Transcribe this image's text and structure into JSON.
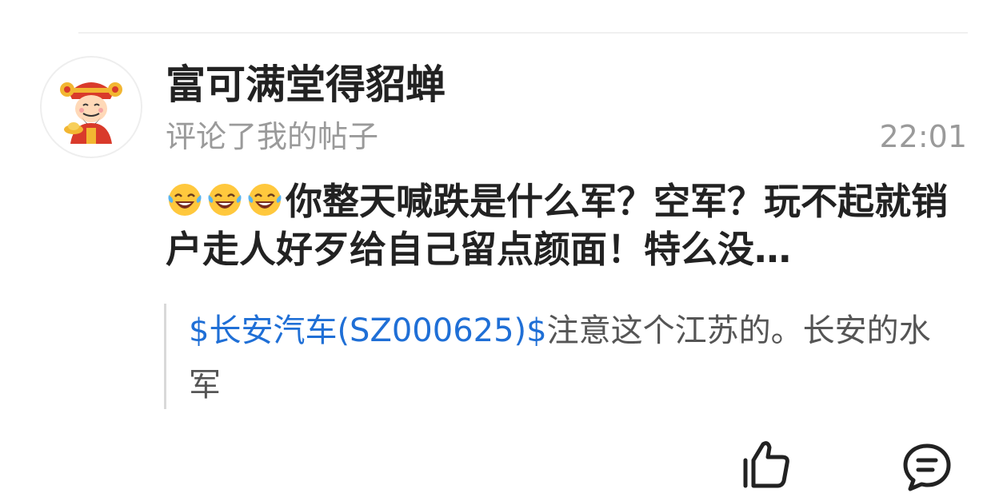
{
  "post": {
    "username": "富可满堂得貂蝉",
    "action": "评论了我的帖子",
    "time": "22:01",
    "emojis": [
      "laughing-crying-emoji",
      "laughing-crying-emoji",
      "laughing-crying-emoji"
    ],
    "comment_text": "你整天喊跌是什么军？空军？玩不起就销户走人好歹给自己留点颜面！特么没…",
    "quote": {
      "stock_link": "$长安汽车(SZ000625)$",
      "text": "注意这个江苏的。长安的水军"
    }
  },
  "actions": {
    "like_icon": "thumbs-up-icon",
    "comment_icon": "comment-bubble-icon"
  },
  "colors": {
    "link": "#1f6fd6",
    "secondary_text": "#9a9a9a",
    "primary_text": "#222222",
    "quote_border": "#d9d9d9"
  }
}
